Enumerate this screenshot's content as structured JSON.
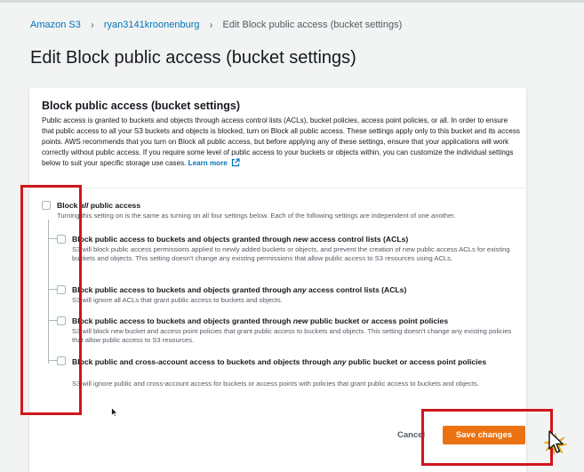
{
  "breadcrumb": {
    "items": [
      "Amazon S3",
      "ryan3141kroonenburg",
      "Edit Block public access (bucket settings)"
    ],
    "separator": "›"
  },
  "page": {
    "title": "Edit Block public access (bucket settings)"
  },
  "panel": {
    "title": "Block public access (bucket settings)",
    "description": "Public access is granted to buckets and objects through access control lists (ACLs), bucket policies, access point policies, or all. In order to ensure that public access to all your S3 buckets and objects is blocked, turn on Block all public access. These settings apply only to this bucket and its access points. AWS recommends that you turn on Block all public access, but before applying any of these settings, ensure that your applications will work correctly without public access. If you require some level of public access to your buckets or objects within, you can customize the individual settings below to suit your specific storage use cases.",
    "learn_more": "Learn more",
    "block_all": {
      "title_pre": "Block ",
      "title_em": "all",
      "title_post": " public access",
      "desc": "Turning this setting on is the same as turning on all four settings below. Each of the following settings are independent of one another.",
      "checked": false
    },
    "options": [
      {
        "title_pre": "Block public access to buckets and objects granted through ",
        "title_em": "new",
        "title_post": " access control lists (ACLs)",
        "desc": "S3 will block public access permissions applied to newly added buckets or objects, and prevent the creation of new public access ACLs for existing buckets and objects. This setting doesn't change any existing permissions that allow public access to S3 resources using ACLs.",
        "checked": false
      },
      {
        "title_pre": "Block public access to buckets and objects granted through ",
        "title_em": "any",
        "title_post": " access control lists (ACLs)",
        "desc": "S3 will ignore all ACLs that grant public access to buckets and objects.",
        "checked": false
      },
      {
        "title_pre": "Block public access to buckets and objects granted through ",
        "title_em": "new",
        "title_post": " public bucket or access point policies",
        "desc": "S3 will block new bucket and access point policies that grant public access to buckets and objects. This setting doesn't change any existing policies that allow public access to S3 resources.",
        "checked": false
      },
      {
        "title_pre": "Block public and cross-account access to buckets and objects through ",
        "title_em": "any",
        "title_post": " public bucket or access point policies",
        "desc": "S3 will ignore public and cross-account access for buckets or access points with policies that grant public access to buckets and objects.",
        "checked": false
      }
    ]
  },
  "footer": {
    "cancel_label": "Cancel",
    "save_label": "Save changes"
  },
  "colors": {
    "accent": "#ec7211",
    "link": "#0073bb",
    "highlight": "#d0151c"
  }
}
